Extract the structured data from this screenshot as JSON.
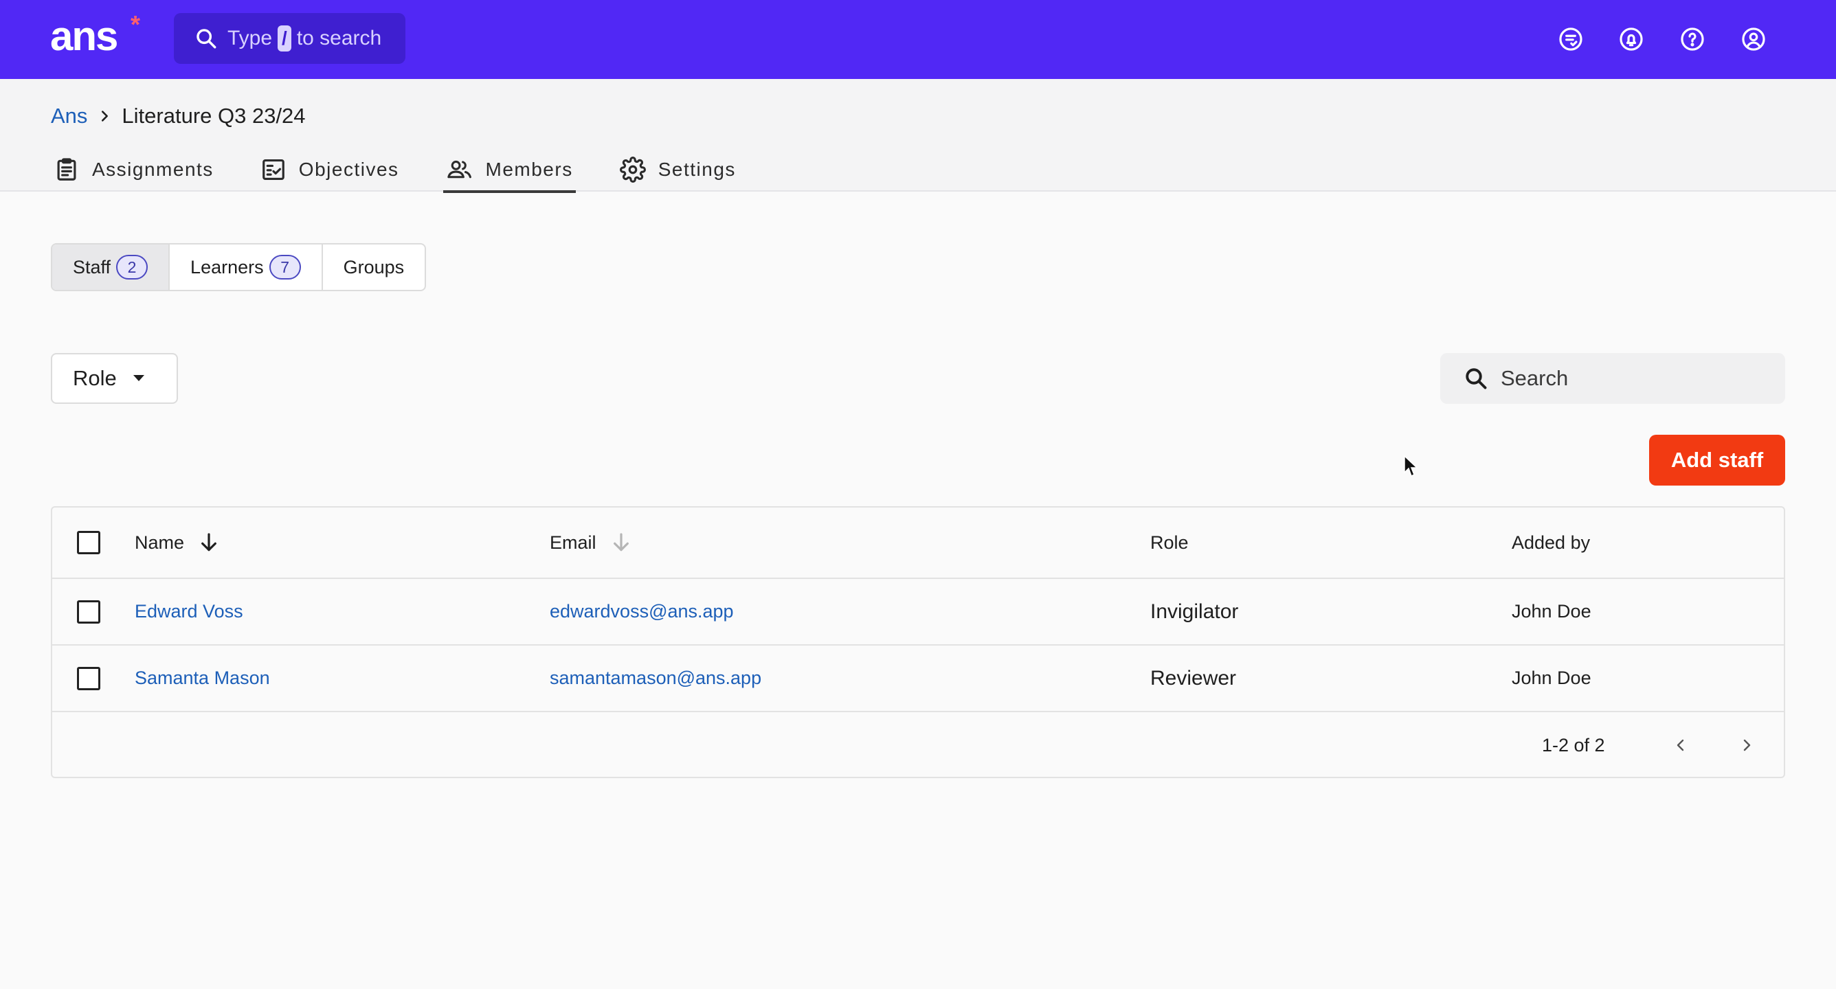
{
  "app": {
    "logo": "ans",
    "logo_star": "*",
    "search_prefix": "Type",
    "search_key": "/",
    "search_suffix": "to search"
  },
  "topbar_icons": [
    "feedback-icon",
    "notifications-icon",
    "help-icon",
    "account-icon"
  ],
  "breadcrumb": {
    "root": "Ans",
    "current": "Literature Q3 23/24"
  },
  "tabs": [
    {
      "label": "Assignments",
      "icon": "clipboard-icon"
    },
    {
      "label": "Objectives",
      "icon": "checklist-icon"
    },
    {
      "label": "Members",
      "icon": "people-icon",
      "active": true
    },
    {
      "label": "Settings",
      "icon": "gear-icon"
    }
  ],
  "segments": [
    {
      "label": "Staff",
      "count": "2",
      "active": true
    },
    {
      "label": "Learners",
      "count": "7"
    },
    {
      "label": "Groups"
    }
  ],
  "filters": {
    "role_label": "Role",
    "search_placeholder": "Search"
  },
  "actions": {
    "add_staff": "Add staff"
  },
  "table": {
    "columns": [
      "Name",
      "Email",
      "Role",
      "Added by"
    ],
    "rows": [
      {
        "name": "Edward Voss",
        "email": "edwardvoss@ans.app",
        "role": "Invigilator",
        "added_by": "John Doe"
      },
      {
        "name": "Samanta Mason",
        "email": "samantamason@ans.app",
        "role": "Reviewer",
        "added_by": "John Doe"
      }
    ],
    "pagination": "1-2 of 2"
  },
  "colors": {
    "brand": "#5128f5",
    "accent": "#f23a12",
    "link": "#1d5fb8"
  }
}
